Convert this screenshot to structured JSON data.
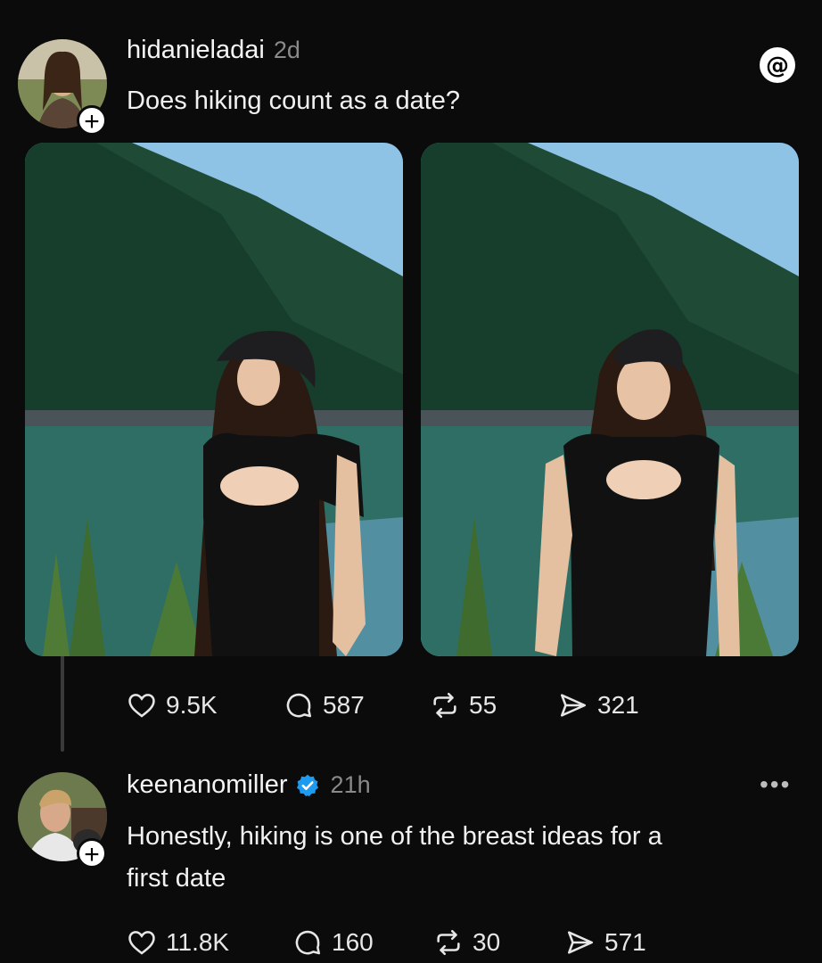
{
  "post": {
    "username": "hidanieladai",
    "time": "2d",
    "text": "Does hiking count as a date?",
    "app_icon": "threads-logo-icon",
    "photos": [
      {
        "description_icon": "photo-woman-looking-away"
      },
      {
        "description_icon": "photo-woman-smiling"
      }
    ],
    "actions": {
      "likes": "9.5K",
      "replies": "587",
      "reposts": "55",
      "shares": "321"
    }
  },
  "reply": {
    "username": "keenanomiller",
    "verified": true,
    "time": "21h",
    "text_line1": "Honestly, hiking is one of the breast ideas for a",
    "text_line2": "first date",
    "actions": {
      "likes": "11.8K",
      "replies": "160",
      "reposts": "30",
      "shares": "571"
    }
  },
  "colors": {
    "background": "#0b0b0c",
    "verified_blue": "#1d9bf0",
    "muted_text": "#8a8a8a"
  }
}
